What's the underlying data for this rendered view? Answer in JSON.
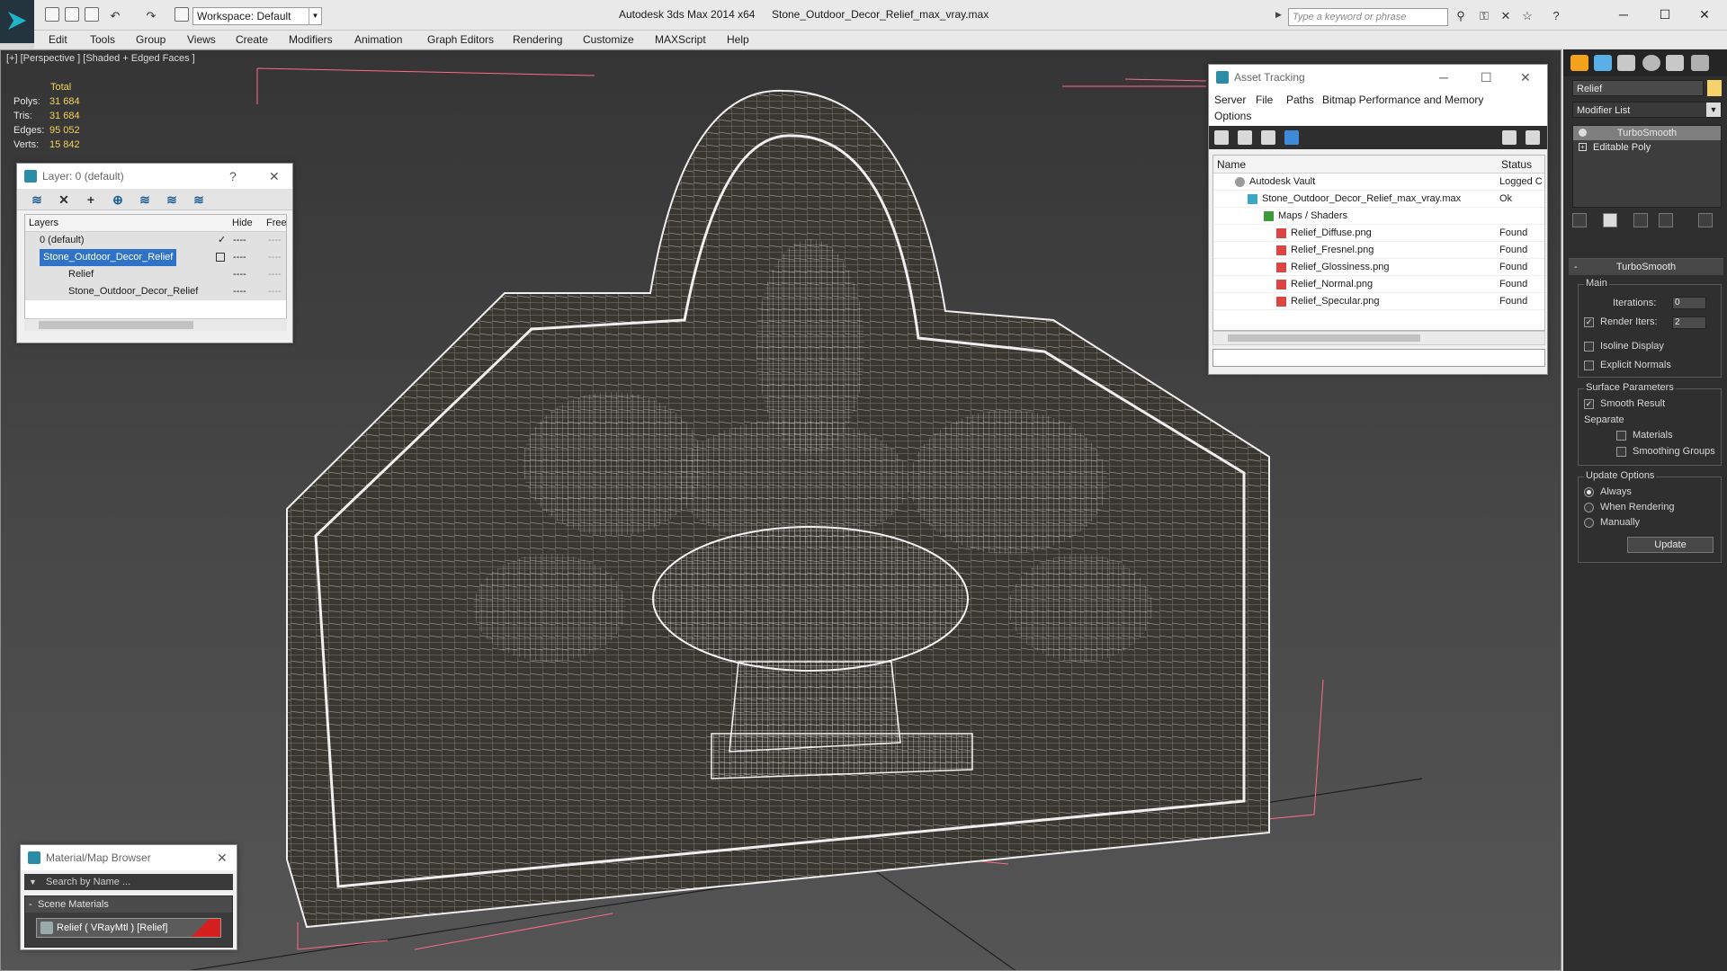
{
  "titlebar": {
    "workspace": "Workspace: Default",
    "app_title": "Autodesk 3ds Max  2014 x64",
    "file_title": "Stone_Outdoor_Decor_Relief_max_vray.max",
    "search_placeholder": "Type a keyword or phrase"
  },
  "menu": [
    "Edit",
    "Tools",
    "Group",
    "Views",
    "Create",
    "Modifiers",
    "Animation",
    "Graph Editors",
    "Rendering",
    "Customize",
    "MAXScript",
    "Help"
  ],
  "viewport": {
    "label": "[+] [Perspective ] [Shaded + Edged Faces ]",
    "stats": {
      "total_label": "Total",
      "rows": [
        {
          "label": "Polys:",
          "value": "31 684"
        },
        {
          "label": "Tris:",
          "value": "31 684"
        },
        {
          "label": "Edges:",
          "value": "95 052"
        },
        {
          "label": "Verts:",
          "value": "15 842"
        }
      ]
    }
  },
  "layer_window": {
    "title": "Layer: 0 (default)",
    "help": "?",
    "close": "✕",
    "columns": {
      "layers": "Layers",
      "hide": "Hide",
      "freeze": "Free"
    },
    "rows": [
      {
        "name": "0 (default)",
        "check": "✓",
        "hide": "----",
        "free": "----"
      },
      {
        "name": "Stone_Outdoor_Decor_Relief",
        "check": "",
        "hide": "----",
        "free": "----"
      },
      {
        "name": "Relief",
        "check": "",
        "hide": "----",
        "free": "----"
      },
      {
        "name": "Stone_Outdoor_Decor_Relief",
        "check": "",
        "hide": "----",
        "free": "----"
      }
    ]
  },
  "asset_window": {
    "title": "Asset Tracking",
    "menu": [
      "Server",
      "File",
      "Paths",
      "Bitmap Performance and Memory",
      "Options"
    ],
    "columns": {
      "name": "Name",
      "status": "Status"
    },
    "rows": [
      {
        "name": "Autodesk Vault",
        "status": "Logged C"
      },
      {
        "name": "Stone_Outdoor_Decor_Relief_max_vray.max",
        "status": "Ok"
      },
      {
        "name": "Maps / Shaders",
        "status": ""
      },
      {
        "name": "Relief_Diffuse.png",
        "status": "Found"
      },
      {
        "name": "Relief_Fresnel.png",
        "status": "Found"
      },
      {
        "name": "Relief_Glossiness.png",
        "status": "Found"
      },
      {
        "name": "Relief_Normal.png",
        "status": "Found"
      },
      {
        "name": "Relief_Specular.png",
        "status": "Found"
      }
    ]
  },
  "material_browser": {
    "title": "Material/Map Browser",
    "search_placeholder": "Search by Name ...",
    "group": "Scene Materials",
    "item": "Relief  ( VRayMtl )  [Relief]",
    "swatch_color": "#d62020"
  },
  "command_panel": {
    "object_name": "Relief",
    "object_color": "#f5d26b",
    "modifier_list": "Modifier List",
    "stack": [
      "TurboSmooth",
      "Editable Poly"
    ],
    "rollout_title": "TurboSmooth",
    "main_group": "Main",
    "iterations_label": "Iterations:",
    "iterations_value": "0",
    "render_iters_label": "Render Iters:",
    "render_iters_value": "2",
    "isoline": "Isoline Display",
    "explicit_normals": "Explicit Normals",
    "surface_group": "Surface Parameters",
    "smooth_result": "Smooth Result",
    "separate": "Separate",
    "materials": "Materials",
    "smoothing_groups": "Smoothing Groups",
    "update_group": "Update Options",
    "always": "Always",
    "when_rendering": "When Rendering",
    "manually": "Manually",
    "update_button": "Update"
  }
}
